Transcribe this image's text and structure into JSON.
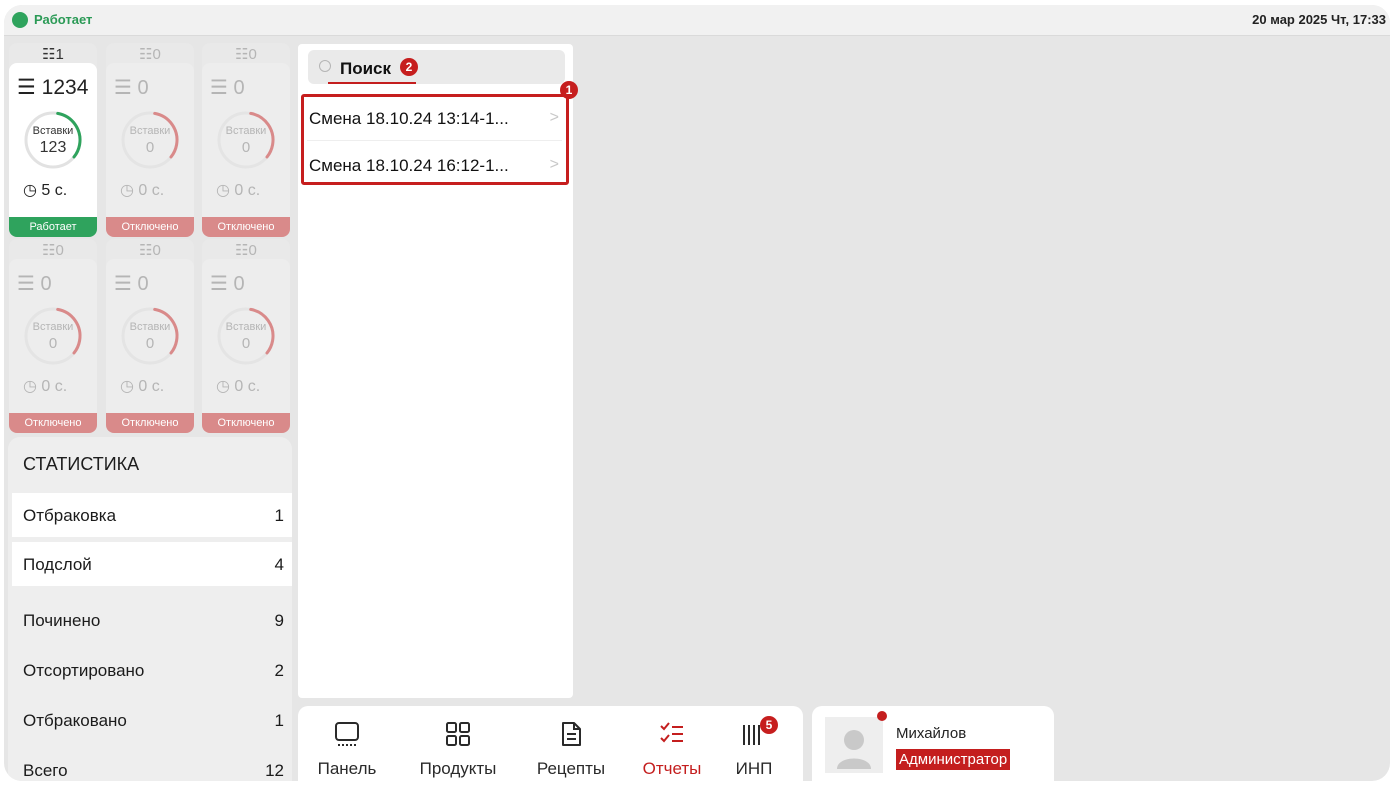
{
  "status_bar": {
    "state": "Работает",
    "datetime": "20 мар 2025 Чт, 17:33",
    "state_color": "#2fa35d"
  },
  "machines": [
    {
      "scan": "1",
      "layers": "1234",
      "ring_label": "Вставки",
      "ring_value": "123",
      "time": "5 с.",
      "state": "Работает",
      "active": true,
      "progress": 0.33
    },
    {
      "scan": "0",
      "layers": "0",
      "ring_label": "Вставки",
      "ring_value": "0",
      "time": "0 с.",
      "state": "Отключено",
      "active": false,
      "progress": 0.33
    },
    {
      "scan": "0",
      "layers": "0",
      "ring_label": "Вставки",
      "ring_value": "0",
      "time": "0 с.",
      "state": "Отключено",
      "active": false,
      "progress": 0.33
    },
    {
      "scan": "0",
      "layers": "0",
      "ring_label": "Вставки",
      "ring_value": "0",
      "time": "0 с.",
      "state": "Отключено",
      "active": false,
      "progress": 0.33
    },
    {
      "scan": "0",
      "layers": "0",
      "ring_label": "Вставки",
      "ring_value": "0",
      "time": "0 с.",
      "state": "Отключено",
      "active": false,
      "progress": 0.33
    },
    {
      "scan": "0",
      "layers": "0",
      "ring_label": "Вставки",
      "ring_value": "0",
      "time": "0 с.",
      "state": "Отключено",
      "active": false,
      "progress": 0.33
    }
  ],
  "statistics": {
    "title": "СТАТИСТИКА",
    "rows": [
      {
        "label": "Отбраковка",
        "value": "1"
      },
      {
        "label": "Подслой",
        "value": "4"
      },
      {
        "label": "Починено",
        "value": "9"
      },
      {
        "label": "Отсортировано",
        "value": "2"
      },
      {
        "label": "Отбраковано",
        "value": "1"
      },
      {
        "label": "Всего",
        "value": "12"
      }
    ]
  },
  "search": {
    "value": "Поиск",
    "badge": "2"
  },
  "shifts": {
    "badge": "1",
    "items": [
      {
        "label": "Смена 18.10.24 13:14-1..."
      },
      {
        "label": "Смена 18.10.24 16:12-1..."
      }
    ]
  },
  "nav": {
    "items": [
      {
        "label": "Панель",
        "icon": "monitor-icon"
      },
      {
        "label": "Продукты",
        "icon": "grid-icon"
      },
      {
        "label": "Рецепты",
        "icon": "document-icon"
      },
      {
        "label": "Отчеты",
        "icon": "checklist-icon",
        "active": true
      },
      {
        "label": "ИНП",
        "icon": "barcode-icon",
        "badge": "5"
      }
    ]
  },
  "user": {
    "name": "Михайлов",
    "role": "Администратор"
  },
  "colors": {
    "accent": "#c41e1e",
    "ok": "#2fa35d",
    "disabled": "#d98a8a"
  }
}
